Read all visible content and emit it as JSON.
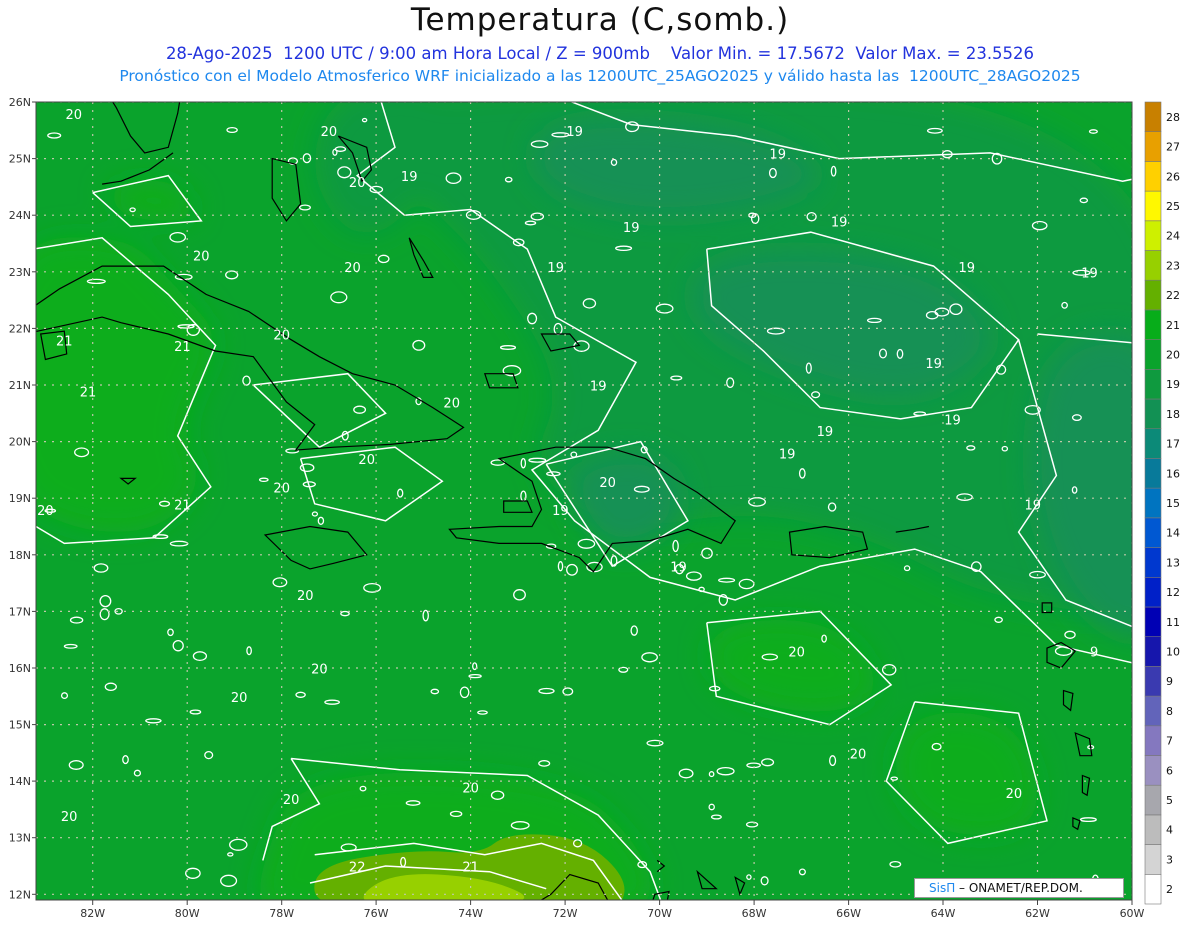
{
  "header": {
    "title": "Temperatura (C,somb.)",
    "subtitle_line1": "28-Ago-2025  1200 UTC / 9:00 am Hora Local / Z = 900mb    Valor Min. = 17.5672  Valor Max. = 23.5526",
    "subtitle_line2": "Pronóstico con el Modelo Atmosferico WRF inicializado a las 1200UTC_25AGO2025 y válido hasta las  1200UTC_28AGO2025"
  },
  "map": {
    "lon_labels": [
      "82W",
      "80W",
      "78W",
      "76W",
      "74W",
      "72W",
      "70W",
      "68W",
      "66W",
      "64W",
      "62W",
      "60W"
    ],
    "lat_labels": [
      "26N",
      "25N",
      "24N",
      "23N",
      "22N",
      "21N",
      "20N",
      "19N",
      "18N",
      "17N",
      "16N",
      "15N",
      "14N",
      "13N",
      "12N"
    ],
    "lon_range": [
      -83.2,
      -60
    ],
    "lat_range": [
      11.9,
      26
    ],
    "grid_style": "dotted",
    "colors": {
      "band_18": "#129154",
      "band_19": "#0f9a3f",
      "band_20": "#0aa32c",
      "band_21": "#07ad1a",
      "band_22": "#64b000",
      "band_23": "#97d000",
      "coastline": "#000000",
      "contour": "#ffffff"
    }
  },
  "contour_labels": [
    {
      "text": "20",
      "lon": -82.4,
      "lat": 25.7
    },
    {
      "text": "20",
      "lon": -77.0,
      "lat": 25.4
    },
    {
      "text": "20",
      "lon": -76.4,
      "lat": 24.5
    },
    {
      "text": "19",
      "lon": -75.3,
      "lat": 24.6
    },
    {
      "text": "19",
      "lon": -71.8,
      "lat": 25.4
    },
    {
      "text": "19",
      "lon": -67.5,
      "lat": 25.0
    },
    {
      "text": "20",
      "lon": -79.7,
      "lat": 23.2
    },
    {
      "text": "20",
      "lon": -76.5,
      "lat": 23.0
    },
    {
      "text": "19",
      "lon": -72.2,
      "lat": 23.0
    },
    {
      "text": "19",
      "lon": -70.6,
      "lat": 23.7
    },
    {
      "text": "19",
      "lon": -66.2,
      "lat": 23.8
    },
    {
      "text": "19",
      "lon": -63.5,
      "lat": 23.0
    },
    {
      "text": "19",
      "lon": -60.9,
      "lat": 22.9
    },
    {
      "text": "21",
      "lon": -82.6,
      "lat": 21.7
    },
    {
      "text": "21",
      "lon": -80.1,
      "lat": 21.6
    },
    {
      "text": "20",
      "lon": -78.0,
      "lat": 21.8
    },
    {
      "text": "19",
      "lon": -64.2,
      "lat": 21.3
    },
    {
      "text": "19",
      "lon": -71.3,
      "lat": 20.9
    },
    {
      "text": "20",
      "lon": -74.4,
      "lat": 20.6
    },
    {
      "text": "21",
      "lon": -82.1,
      "lat": 20.8
    },
    {
      "text": "19",
      "lon": -63.8,
      "lat": 20.3
    },
    {
      "text": "19",
      "lon": -66.5,
      "lat": 20.1
    },
    {
      "text": "19",
      "lon": -67.3,
      "lat": 19.7
    },
    {
      "text": "20",
      "lon": -76.2,
      "lat": 19.6
    },
    {
      "text": "20",
      "lon": -78.0,
      "lat": 19.1
    },
    {
      "text": "20",
      "lon": -71.1,
      "lat": 19.2
    },
    {
      "text": "20",
      "lon": -83.0,
      "lat": 18.7
    },
    {
      "text": "21",
      "lon": -80.1,
      "lat": 18.8
    },
    {
      "text": "19",
      "lon": -72.1,
      "lat": 18.7
    },
    {
      "text": "19",
      "lon": -62.1,
      "lat": 18.8
    },
    {
      "text": "19",
      "lon": -69.6,
      "lat": 17.7
    },
    {
      "text": "20",
      "lon": -77.5,
      "lat": 17.2
    },
    {
      "text": "20",
      "lon": -67.1,
      "lat": 16.2
    },
    {
      "text": "20",
      "lon": -77.2,
      "lat": 15.9
    },
    {
      "text": "9",
      "lon": -60.8,
      "lat": 16.2
    },
    {
      "text": "20",
      "lon": -78.9,
      "lat": 15.4
    },
    {
      "text": "20",
      "lon": -65.8,
      "lat": 14.4
    },
    {
      "text": "20",
      "lon": -62.5,
      "lat": 13.7
    },
    {
      "text": "20",
      "lon": -74.0,
      "lat": 13.8
    },
    {
      "text": "20",
      "lon": -77.8,
      "lat": 13.6
    },
    {
      "text": "20",
      "lon": -82.5,
      "lat": 13.3
    },
    {
      "text": "21",
      "lon": -74.0,
      "lat": 12.4
    },
    {
      "text": "22",
      "lon": -76.4,
      "lat": 12.4
    }
  ],
  "colorbar": {
    "levels": [
      {
        "label": "2",
        "color": "#ffffff"
      },
      {
        "label": "3",
        "color": "#d4d4d4"
      },
      {
        "label": "4",
        "color": "#bcbcbc"
      },
      {
        "label": "5",
        "color": "#a7a7ad"
      },
      {
        "label": "6",
        "color": "#9a90c0"
      },
      {
        "label": "7",
        "color": "#8478bf"
      },
      {
        "label": "8",
        "color": "#6264ba"
      },
      {
        "label": "9",
        "color": "#3a3ab0"
      },
      {
        "label": "10",
        "color": "#1616ac"
      },
      {
        "label": "11",
        "color": "#0000b4"
      },
      {
        "label": "12",
        "color": "#0020c8"
      },
      {
        "label": "13",
        "color": "#0038cf"
      },
      {
        "label": "14",
        "color": "#0058d2"
      },
      {
        "label": "15",
        "color": "#0074c0"
      },
      {
        "label": "16",
        "color": "#087a9a"
      },
      {
        "label": "17",
        "color": "#0c8a78"
      },
      {
        "label": "18",
        "color": "#129154"
      },
      {
        "label": "19",
        "color": "#0f9a3f"
      },
      {
        "label": "20",
        "color": "#0aa32c"
      },
      {
        "label": "21",
        "color": "#07ad1a"
      },
      {
        "label": "22",
        "color": "#64b000"
      },
      {
        "label": "23",
        "color": "#97d000"
      },
      {
        "label": "24",
        "color": "#cef000"
      },
      {
        "label": "25",
        "color": "#fff800"
      },
      {
        "label": "26",
        "color": "#ffd000"
      },
      {
        "label": "27",
        "color": "#e8a000"
      },
      {
        "label": "28",
        "color": "#c88000"
      }
    ]
  },
  "credit": {
    "logo": "SisΠ",
    "org": " – ONAMET/REP.DOM."
  }
}
